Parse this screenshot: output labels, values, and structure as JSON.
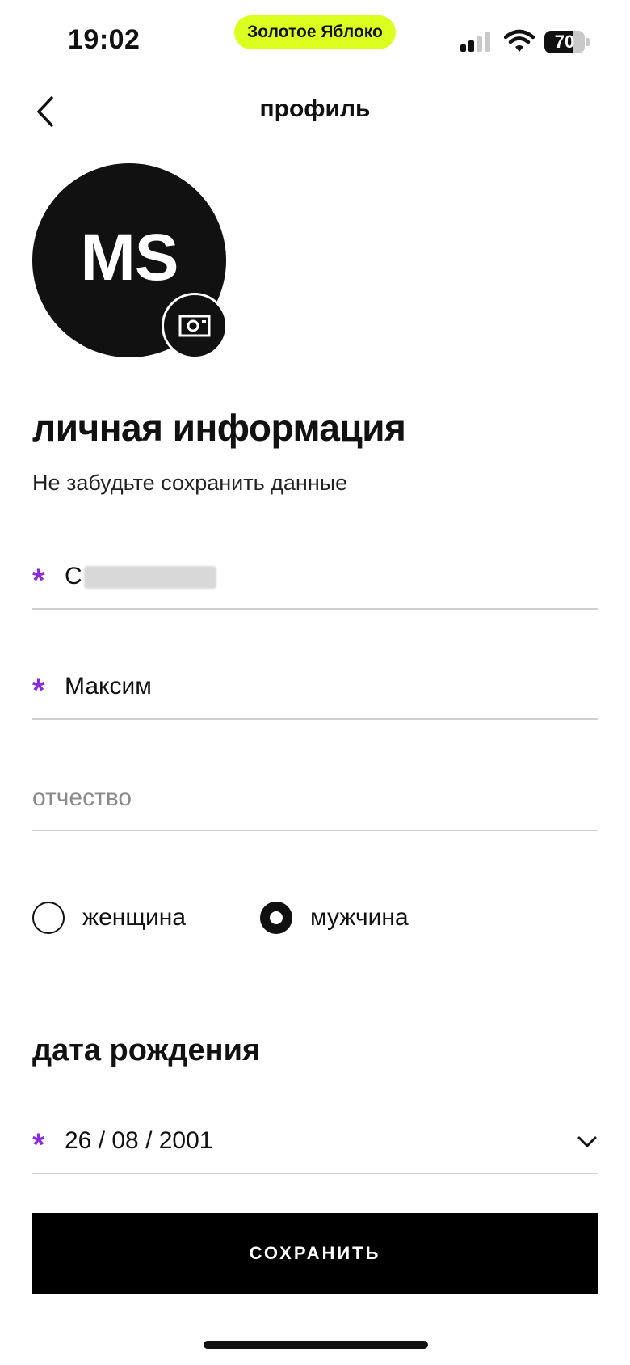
{
  "status_bar": {
    "time": "19:02",
    "app_pill": "Золотое Яблоко",
    "battery_level": "70",
    "battery_fraction": 0.7,
    "pill_color": "#dcff1f"
  },
  "header": {
    "title": "профиль",
    "back_icon": "chevron-left-icon"
  },
  "avatar": {
    "initials": "MS",
    "camera_icon": "camera-icon"
  },
  "personal_info": {
    "title": "личная информация",
    "subtitle": "Не забудьте сохранить данные",
    "required_mark": "*",
    "required_color": "#8a2be2",
    "last_name": "С",
    "first_name": "Максим",
    "patronymic_placeholder": "отчество"
  },
  "gender": {
    "options": [
      {
        "label": "женщина",
        "selected": false
      },
      {
        "label": "мужчина",
        "selected": true
      }
    ]
  },
  "birth_date": {
    "title": "дата рождения",
    "value": "26 / 08 / 2001",
    "dropdown_icon": "chevron-down-icon"
  },
  "actions": {
    "save_label": "СОХРАНИТЬ"
  }
}
